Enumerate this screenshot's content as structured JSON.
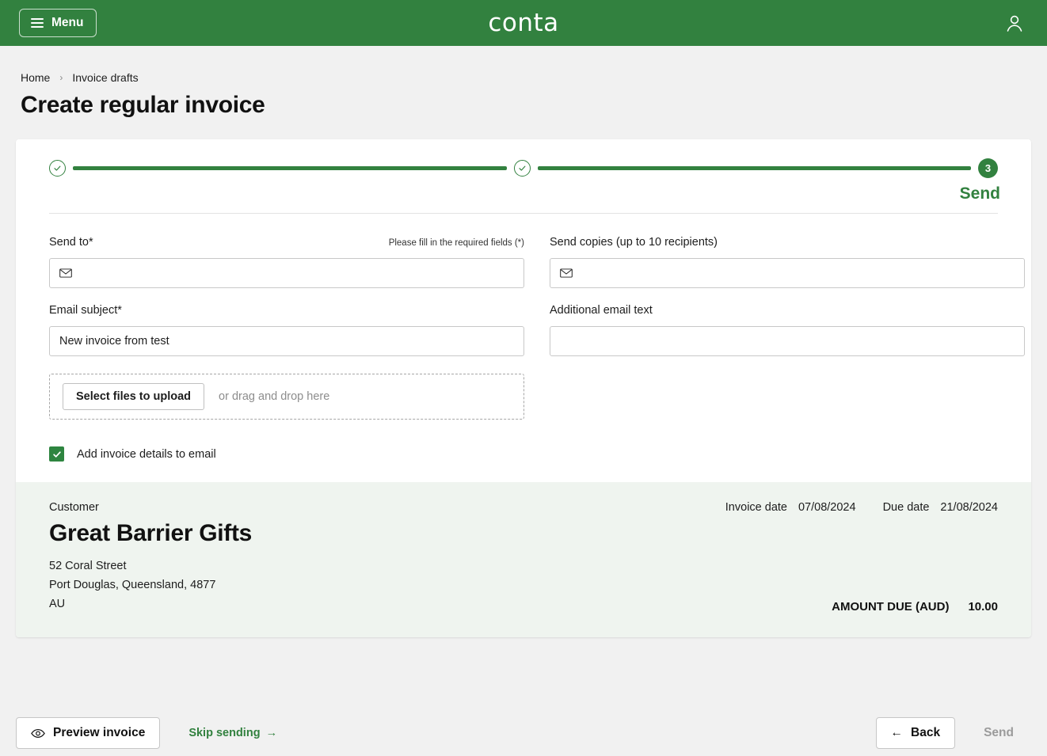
{
  "header": {
    "menu_label": "Menu",
    "logo_text": "conta",
    "account_icon": "user-icon"
  },
  "breadcrumb": {
    "home": "Home",
    "separator": "›",
    "current": "Invoice drafts"
  },
  "page_title": "Create regular invoice",
  "stepper": {
    "step1_state": "completed",
    "step2_state": "completed",
    "step3_number": "3",
    "step3_label": "Send"
  },
  "form": {
    "send_to": {
      "label": "Send to*",
      "required_note": "Please fill in the required fields (*)",
      "value": "",
      "placeholder": "",
      "icon": "envelope-icon"
    },
    "send_copies": {
      "label": "Send copies (up to 10 recipients)",
      "value": "",
      "placeholder": "",
      "icon": "envelope-icon"
    },
    "email_subject": {
      "label": "Email subject*",
      "value": "New invoice from test",
      "placeholder": ""
    },
    "additional_email_text": {
      "label": "Additional email text",
      "value": "",
      "placeholder": ""
    },
    "upload": {
      "button_label": "Select files to upload",
      "hint": "or drag and drop here"
    },
    "add_details_checkbox": {
      "label": "Add invoice details to email",
      "checked": true
    }
  },
  "summary": {
    "customer_kicker": "Customer",
    "customer_name": "Great Barrier Gifts",
    "address_line1": "52 Coral Street",
    "address_line2": "Port Douglas, Queensland, 4877",
    "address_line3": "AU",
    "invoice_date_label": "Invoice date",
    "invoice_date_value": "07/08/2024",
    "due_date_label": "Due date",
    "due_date_value": "21/08/2024",
    "amount_due_label": "AMOUNT DUE (AUD)",
    "amount_due_value": "10.00"
  },
  "footer": {
    "preview_label": "Preview invoice",
    "skip_label": "Skip sending",
    "skip_arrow": "→",
    "back_label": "Back",
    "back_arrow": "←",
    "send_label": "Send"
  },
  "colors": {
    "brand_green": "#32813f",
    "panel_tint": "#eff4ef",
    "checkbox_green": "#2e8540",
    "page_bg": "#f1f1f1"
  }
}
